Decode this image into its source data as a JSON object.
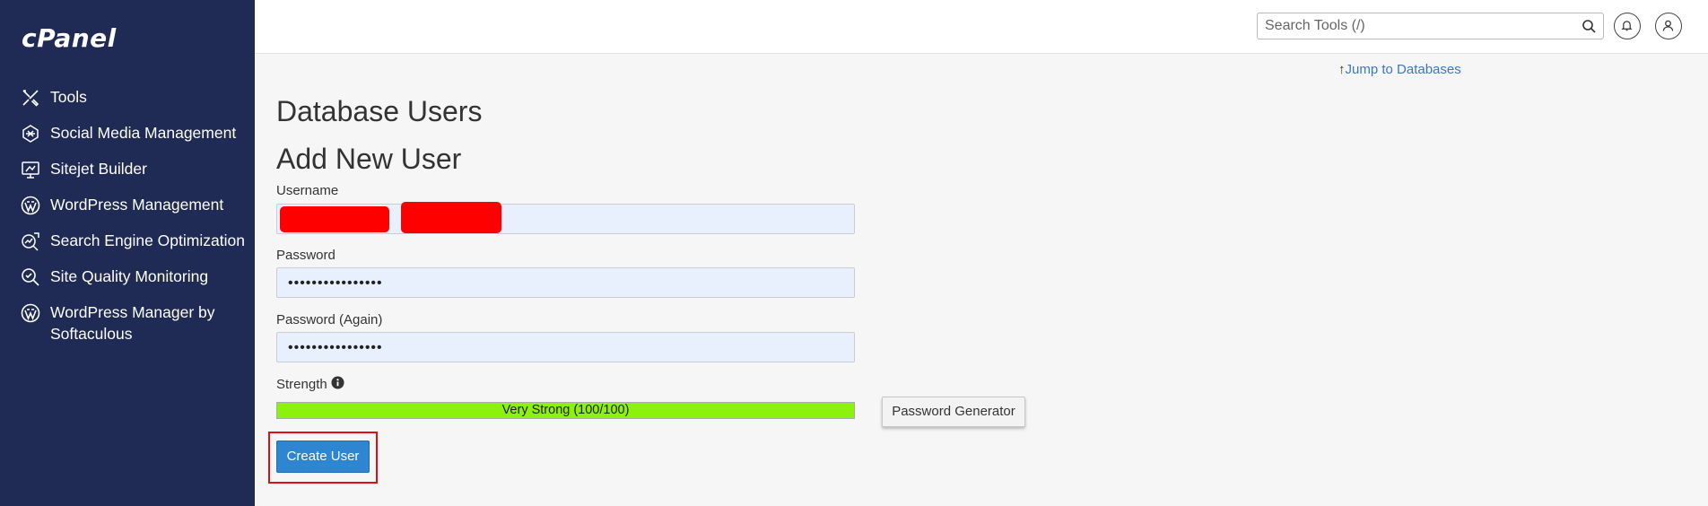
{
  "app": {
    "logo_text": "cPanel"
  },
  "sidebar": {
    "items": [
      {
        "label": "Tools",
        "icon": "tools-icon"
      },
      {
        "label": "Social Media Management",
        "icon": "social-media-icon"
      },
      {
        "label": "Sitejet Builder",
        "icon": "sitejet-icon"
      },
      {
        "label": "WordPress Management",
        "icon": "wordpress-icon"
      },
      {
        "label": "Search Engine Optimization",
        "icon": "seo-icon"
      },
      {
        "label": "Site Quality Monitoring",
        "icon": "site-quality-icon"
      },
      {
        "label": "WordPress Manager by Softaculous",
        "icon": "wordpress-icon"
      }
    ]
  },
  "header": {
    "search_placeholder": "Search Tools (/)",
    "search_icon": "search-icon",
    "notifications_icon": "bell-icon",
    "user_icon": "user-icon"
  },
  "main": {
    "jump_link": "Jump to Databases",
    "page_title": "Database Users",
    "section_title": "Add New User",
    "username_label": "Username",
    "username_value": "",
    "password_label": "Password",
    "password_value": "••••••••••••••••",
    "password_again_label": "Password (Again)",
    "password_again_value": "••••••••••••••••",
    "strength_label": "Strength",
    "strength_text": "Very Strong (100/100)",
    "strength_score": 100,
    "password_generator_label": "Password Generator",
    "create_user_label": "Create User"
  },
  "colors": {
    "sidebar_bg": "#1f2a55",
    "strength_bar": "#8cf20c",
    "primary_button": "#2e86d0",
    "link": "#3b78c4",
    "redaction": "#ff0000",
    "highlight_box": "#e01010"
  }
}
